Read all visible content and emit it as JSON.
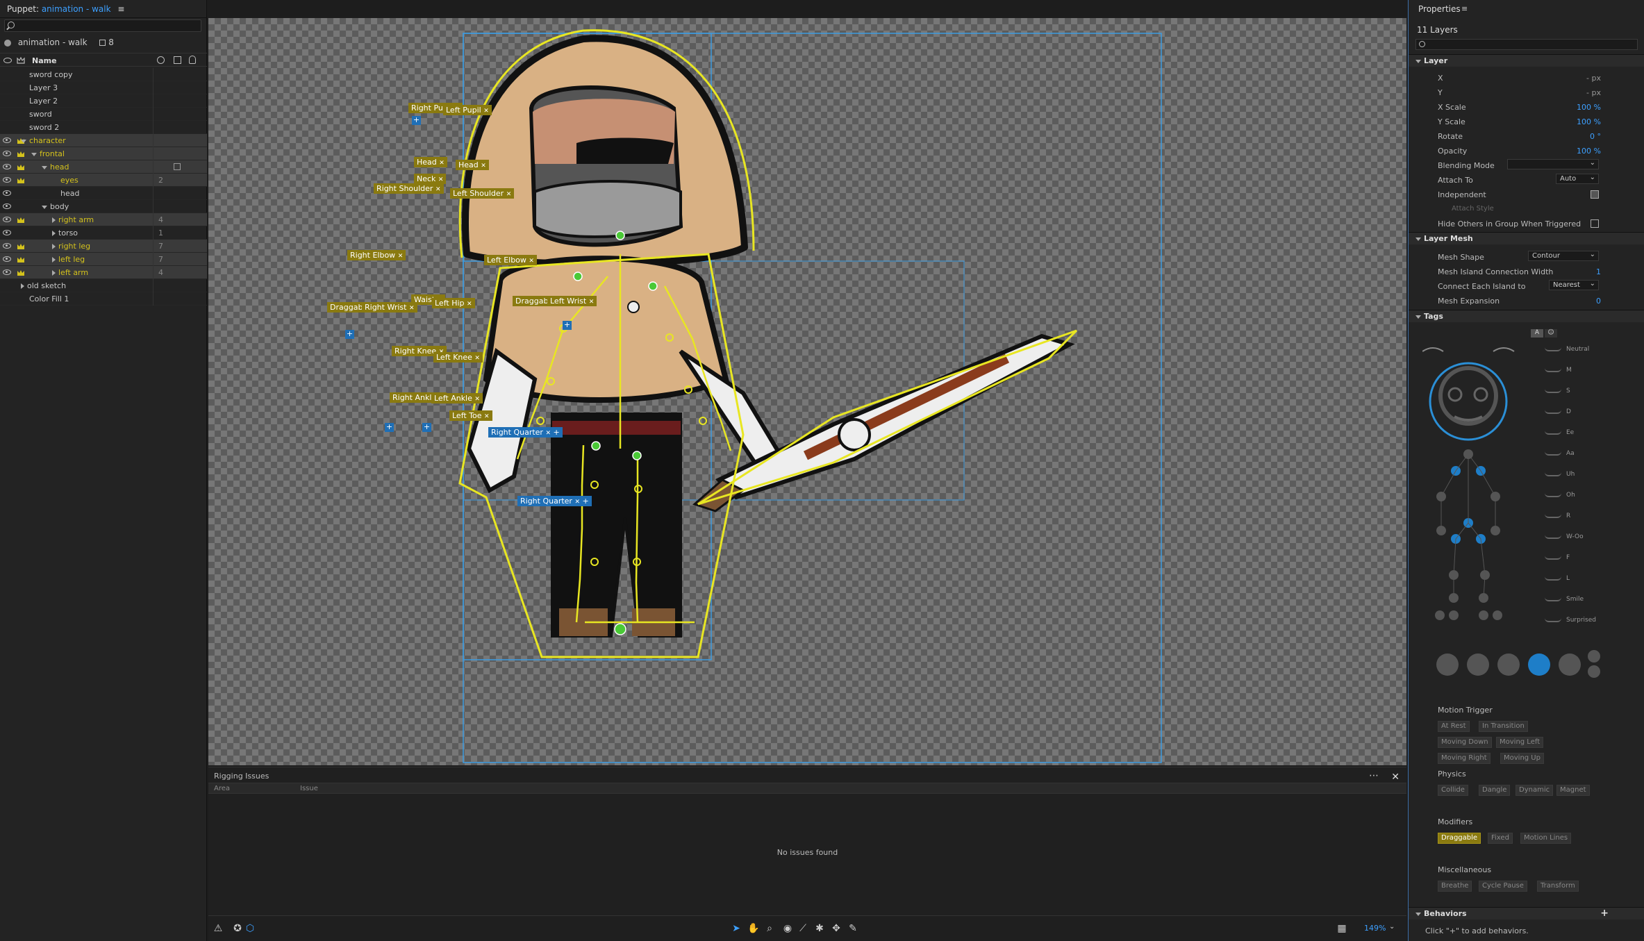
{
  "puppet_panel": {
    "title_prefix": "Puppet:",
    "puppet_name": "animation - walk",
    "puppet_row_name": "animation - walk",
    "puppet_row_count": "8",
    "column_name": "Name",
    "layers": [
      {
        "name": "sword copy",
        "indent": 0,
        "expand": "",
        "vis": false,
        "tagged": false,
        "num": "",
        "sel": false
      },
      {
        "name": "Layer 3",
        "indent": 0,
        "expand": "",
        "vis": false,
        "tagged": false,
        "num": "",
        "sel": false
      },
      {
        "name": "Layer 2",
        "indent": 0,
        "expand": "",
        "vis": false,
        "tagged": false,
        "num": "",
        "sel": false
      },
      {
        "name": "sword",
        "indent": 0,
        "expand": "",
        "vis": false,
        "tagged": false,
        "num": "",
        "sel": false
      },
      {
        "name": "sword 2",
        "indent": 0,
        "expand": "",
        "vis": false,
        "tagged": false,
        "num": "",
        "sel": false
      },
      {
        "name": "character",
        "indent": 0,
        "expand": "open",
        "vis": true,
        "tagged": true,
        "num": "",
        "sel": true
      },
      {
        "name": "frontal",
        "indent": 1,
        "expand": "open",
        "vis": true,
        "tagged": true,
        "num": "",
        "sel": true
      },
      {
        "name": "head",
        "indent": 2,
        "expand": "open",
        "vis": true,
        "tagged": true,
        "num": "",
        "sel": true
      },
      {
        "name": "eyes",
        "indent": 3,
        "expand": "",
        "vis": true,
        "tagged": true,
        "num": "2",
        "sel": true
      },
      {
        "name": "head",
        "indent": 3,
        "expand": "",
        "vis": true,
        "tagged": false,
        "num": "",
        "sel": false
      },
      {
        "name": "body",
        "indent": 2,
        "expand": "open",
        "vis": true,
        "tagged": false,
        "num": "",
        "sel": false
      },
      {
        "name": "right arm",
        "indent": 3,
        "expand": "closed",
        "vis": true,
        "tagged": true,
        "num": "4",
        "sel": true
      },
      {
        "name": "torso",
        "indent": 3,
        "expand": "closed",
        "vis": true,
        "tagged": false,
        "num": "1",
        "sel": false
      },
      {
        "name": "right leg",
        "indent": 3,
        "expand": "closed",
        "vis": true,
        "tagged": true,
        "num": "7",
        "sel": true
      },
      {
        "name": "left leg",
        "indent": 3,
        "expand": "closed",
        "vis": true,
        "tagged": true,
        "num": "7",
        "sel": true
      },
      {
        "name": "left arm",
        "indent": 3,
        "expand": "closed",
        "vis": true,
        "tagged": true,
        "num": "4",
        "sel": true
      },
      {
        "name": "old sketch",
        "indent": 0,
        "expand": "closed",
        "vis": false,
        "tagged": false,
        "num": "",
        "sel": false
      },
      {
        "name": "Color Fill 1",
        "indent": 0,
        "expand": "",
        "vis": false,
        "tagged": false,
        "num": "",
        "sel": false
      }
    ]
  },
  "canvas": {
    "handles": [
      "Right Pupil",
      "Left Pupil",
      "Head",
      "Head",
      "Neck",
      "Right Shoulder",
      "Left Shoulder",
      "Right Elbow",
      "Left Elbow",
      "Draggable",
      "Right Wrist",
      "Waist",
      "Left Hip",
      "Draggable",
      "Left Wrist",
      "Right Knee",
      "Left Knee",
      "Right Ankle",
      "Left Ankle",
      "Left Toe"
    ],
    "view_labels": [
      "Right Quarter",
      "Right Quarter"
    ]
  },
  "rigging": {
    "title": "Rigging Issues",
    "col_area": "Area",
    "col_issue": "Issue",
    "empty": "No issues found"
  },
  "toolbar": {
    "zoom": "149%"
  },
  "properties": {
    "title": "Properties",
    "layer_count": "11 Layers",
    "layer_section": "Layer",
    "x_label": "X",
    "x_value": "- px",
    "y_label": "Y",
    "y_value": "- px",
    "xscale_label": "X Scale",
    "xscale_value": "100 %",
    "yscale_label": "Y Scale",
    "yscale_value": "100 %",
    "rotate_label": "Rotate",
    "rotate_value": "0 °",
    "opacity_label": "Opacity",
    "opacity_value": "100 %",
    "blend_label": "Blending Mode",
    "attach_label": "Attach To",
    "attach_value": "Auto",
    "independent_label": "Independent",
    "attach_style_label": "Attach Style",
    "hide_label": "Hide Others in Group When Triggered",
    "mesh_section": "Layer Mesh",
    "mesh_shape_label": "Mesh Shape",
    "mesh_shape_value": "Contour",
    "island_label": "Mesh Island Connection Width",
    "island_value": "1",
    "connect_label": "Connect Each Island to",
    "connect_value": "Nearest",
    "expansion_label": "Mesh Expansion",
    "expansion_value": "0",
    "tags_section": "Tags",
    "visemes": [
      "Neutral",
      "M",
      "S",
      "D",
      "Ee",
      "Aa",
      "Uh",
      "Oh",
      "R",
      "W-Oo",
      "F",
      "L",
      "Smile",
      "Surprised"
    ],
    "motion_trigger": {
      "label": "Motion Trigger",
      "items": [
        "At Rest",
        "In Transition",
        "Moving Down",
        "Moving Left",
        "Moving Right",
        "Moving Up"
      ]
    },
    "physics": {
      "label": "Physics",
      "items": [
        "Collide",
        "Dangle",
        "Dynamic",
        "Magnet"
      ]
    },
    "modifiers": {
      "label": "Modifiers",
      "items": [
        "Draggable",
        "Fixed",
        "Motion Lines"
      ]
    },
    "misc": {
      "label": "Miscellaneous",
      "items": [
        "Breathe",
        "Cycle Pause",
        "Transform"
      ]
    },
    "behaviors_section": "Behaviors",
    "behaviors_hint": "Click \"+\" to add behaviors."
  },
  "colors": {
    "accent": "#3da0ff",
    "tag_yellow": "#d4c21c",
    "tag_bg": "#8a7a10"
  }
}
